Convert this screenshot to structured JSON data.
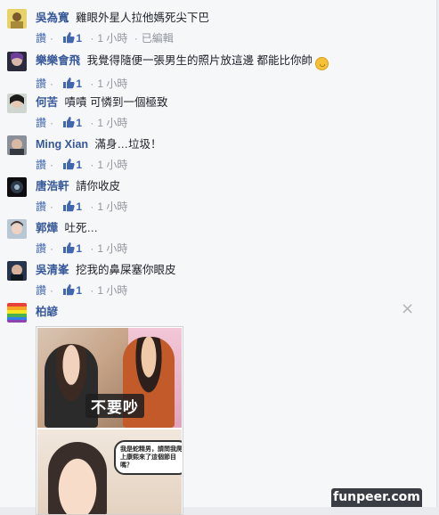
{
  "comments": [
    {
      "author": "吳為寬",
      "text": "雞眼外星人拉他媽死尖下巴",
      "reply": "讚",
      "likes": "1",
      "time": "1 小時",
      "edited": "已編輯"
    },
    {
      "author": "樂樂會飛",
      "text": "我覺得隨便一張男生的照片放這邊 都能比你帥",
      "reply": "讚",
      "likes": "1",
      "time": "1 小時"
    },
    {
      "author": "何苦",
      "text": "嘖嘖 可憐到一個極致",
      "reply": "讚",
      "likes": "1",
      "time": "1 小時"
    },
    {
      "author": "Ming Xian",
      "text": "滿身…垃圾！",
      "reply": "讚",
      "likes": "1",
      "time": "1 小時"
    },
    {
      "author": "唐浩軒",
      "text": "請你收皮",
      "reply": "讚",
      "likes": "1",
      "time": "1 小時"
    },
    {
      "author": "郭燁",
      "text": "吐死…",
      "reply": "讚",
      "likes": "1",
      "time": "1 小時"
    },
    {
      "author": "吳清峯",
      "text": "挖我的鼻屎塞你眼皮",
      "reply": "讚",
      "likes": "1",
      "time": "1 小時"
    },
    {
      "author": "柏諺",
      "text": ""
    }
  ],
  "attachment": {
    "caption_top": "不要吵",
    "bubble_text": "我是蛇精男，請問我爬上康熙來了這個節目嗎？"
  },
  "close_symbol": "×",
  "watermark": "funpeer.com",
  "colors": {
    "link": "#365899",
    "meta": "#90949c",
    "like_blue": "#4267b2"
  }
}
